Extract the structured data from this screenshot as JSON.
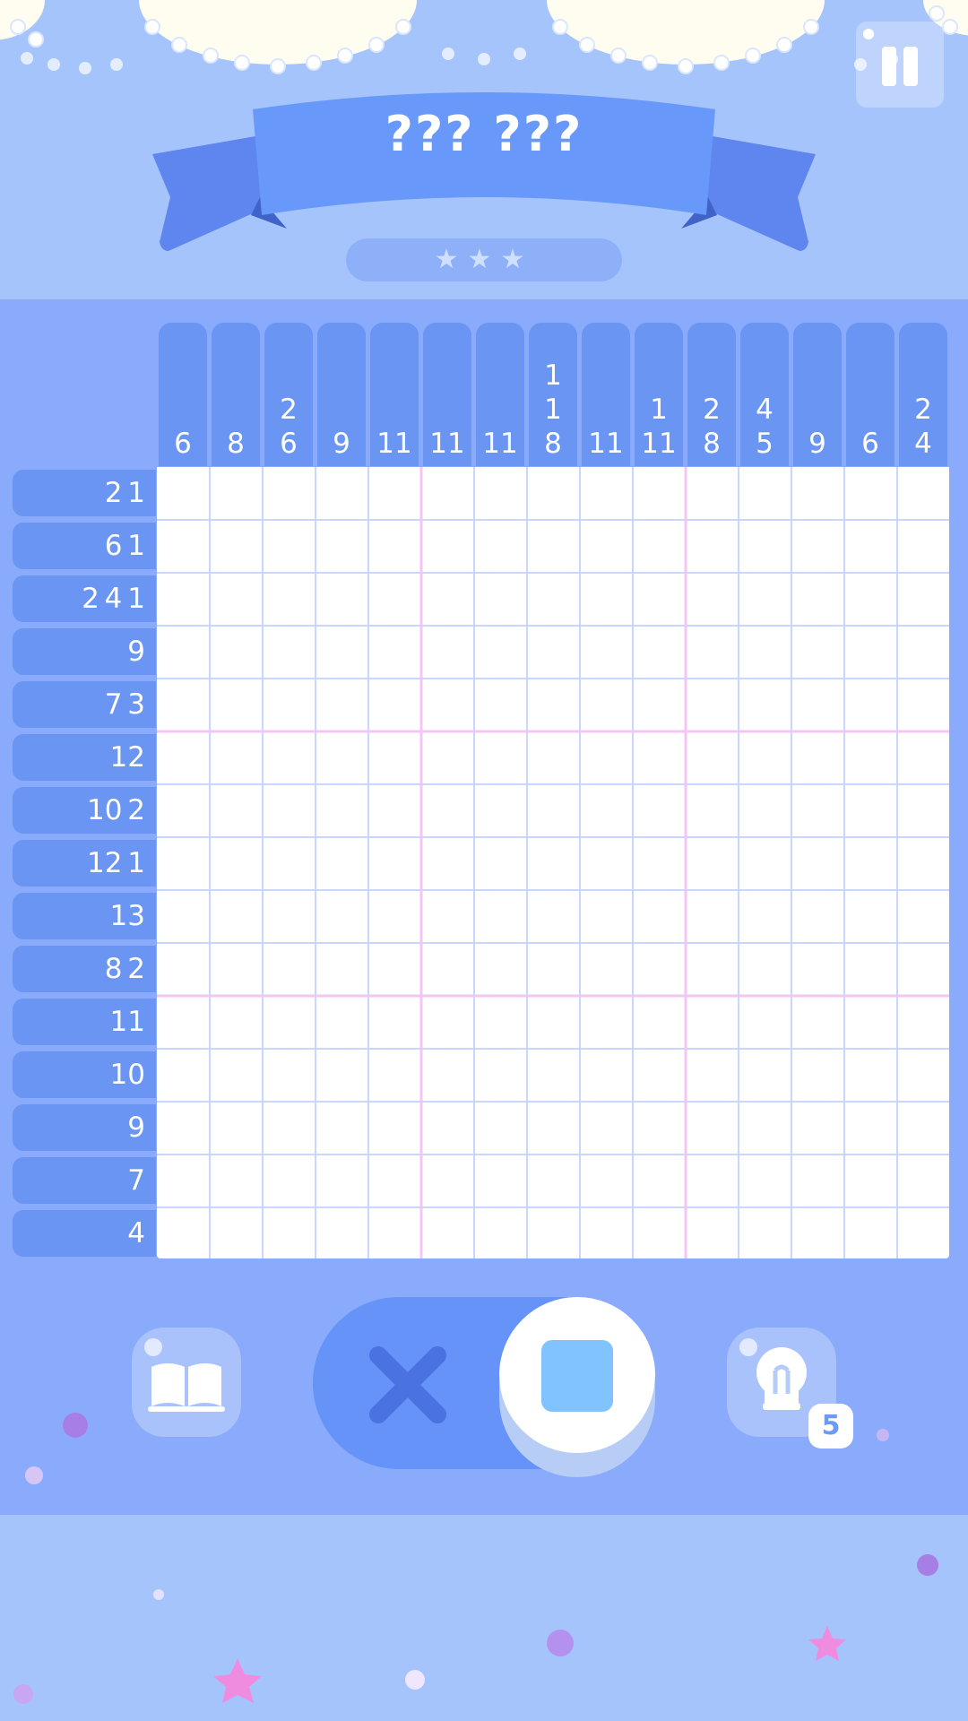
{
  "header": {
    "title": "??? ???",
    "stars": "★★★"
  },
  "puzzle": {
    "size": [
      15,
      15
    ],
    "column_clues": [
      "6",
      "8",
      "2\n6",
      "9",
      "11",
      "11",
      "11",
      "1\n1\n8",
      "11",
      "1\n11",
      "2\n8",
      "4\n5",
      "9",
      "6",
      "2\n4"
    ],
    "row_clues": [
      "2 1",
      "6 1",
      "2 4 1",
      "9",
      "7 3",
      "12",
      "10 2",
      "12 1",
      "13",
      "8 2",
      "11",
      "10",
      "9",
      "7",
      "4"
    ]
  },
  "controls": {
    "mode_toggle": {
      "modes": [
        "cross",
        "fill"
      ],
      "selected": "fill"
    },
    "hint_count": "5"
  },
  "icons": {
    "pause": "pause-icon",
    "book": "book-icon",
    "cross": "cross-icon",
    "fill": "fill-square-icon",
    "hint": "lightbulb-icon"
  },
  "colors": {
    "background": "#a6c4fc",
    "board": "#8aabfb",
    "clue_bg": "#6b95f2",
    "grid_line": "#c9d6ff",
    "grid_major_line": "#f4c4f4",
    "fill_accent": "#80c3fe",
    "toggle": "#6593f8",
    "cross": "#4a72e0"
  }
}
